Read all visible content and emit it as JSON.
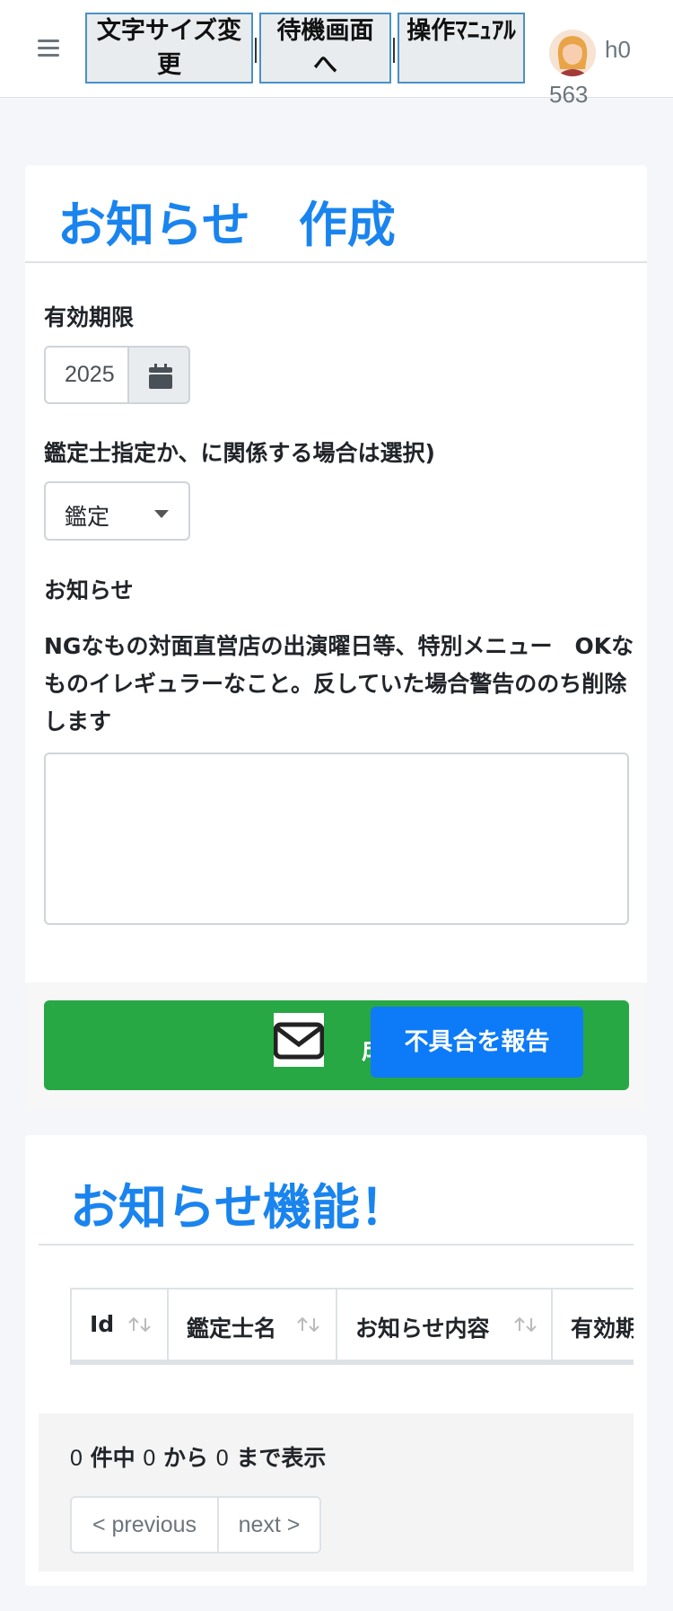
{
  "navbar": {
    "buttons": [
      "文字サイズ変更",
      "待機画面へ",
      "操作ﾏﾆｭｱﾙ"
    ],
    "user_name": "h0",
    "user_id": "563"
  },
  "form": {
    "title": "お知らせ　作成",
    "expiry_label": "有効期限",
    "expiry_value": "2025",
    "appraiser_label": "鑑定士指定か、に関係する場合は選択)",
    "appraiser_select": "鑑定",
    "notice_label": "お知らせ",
    "notice_desc": "NGなもの対面直営店の出演曜日等、特別メニュー　OKなものイレギュラーなこと。反していた場合警告ののち削除します",
    "notice_text": "",
    "submit_label": "成"
  },
  "report_button": "不具合を報告",
  "list": {
    "title": "お知らせ機能！",
    "columns": [
      "Id",
      "鑑定士名",
      "お知らせ内容",
      "有効期"
    ],
    "info": {
      "total": "0",
      "from": "0",
      "to": "0",
      "t1": "件中",
      "t2": "から",
      "t3": "まで表示"
    },
    "prev_label": "< previous",
    "next_label": "next >"
  },
  "colors": {
    "accent": "#1a84ee",
    "success": "#28a745",
    "report": "#0d7bf7"
  }
}
